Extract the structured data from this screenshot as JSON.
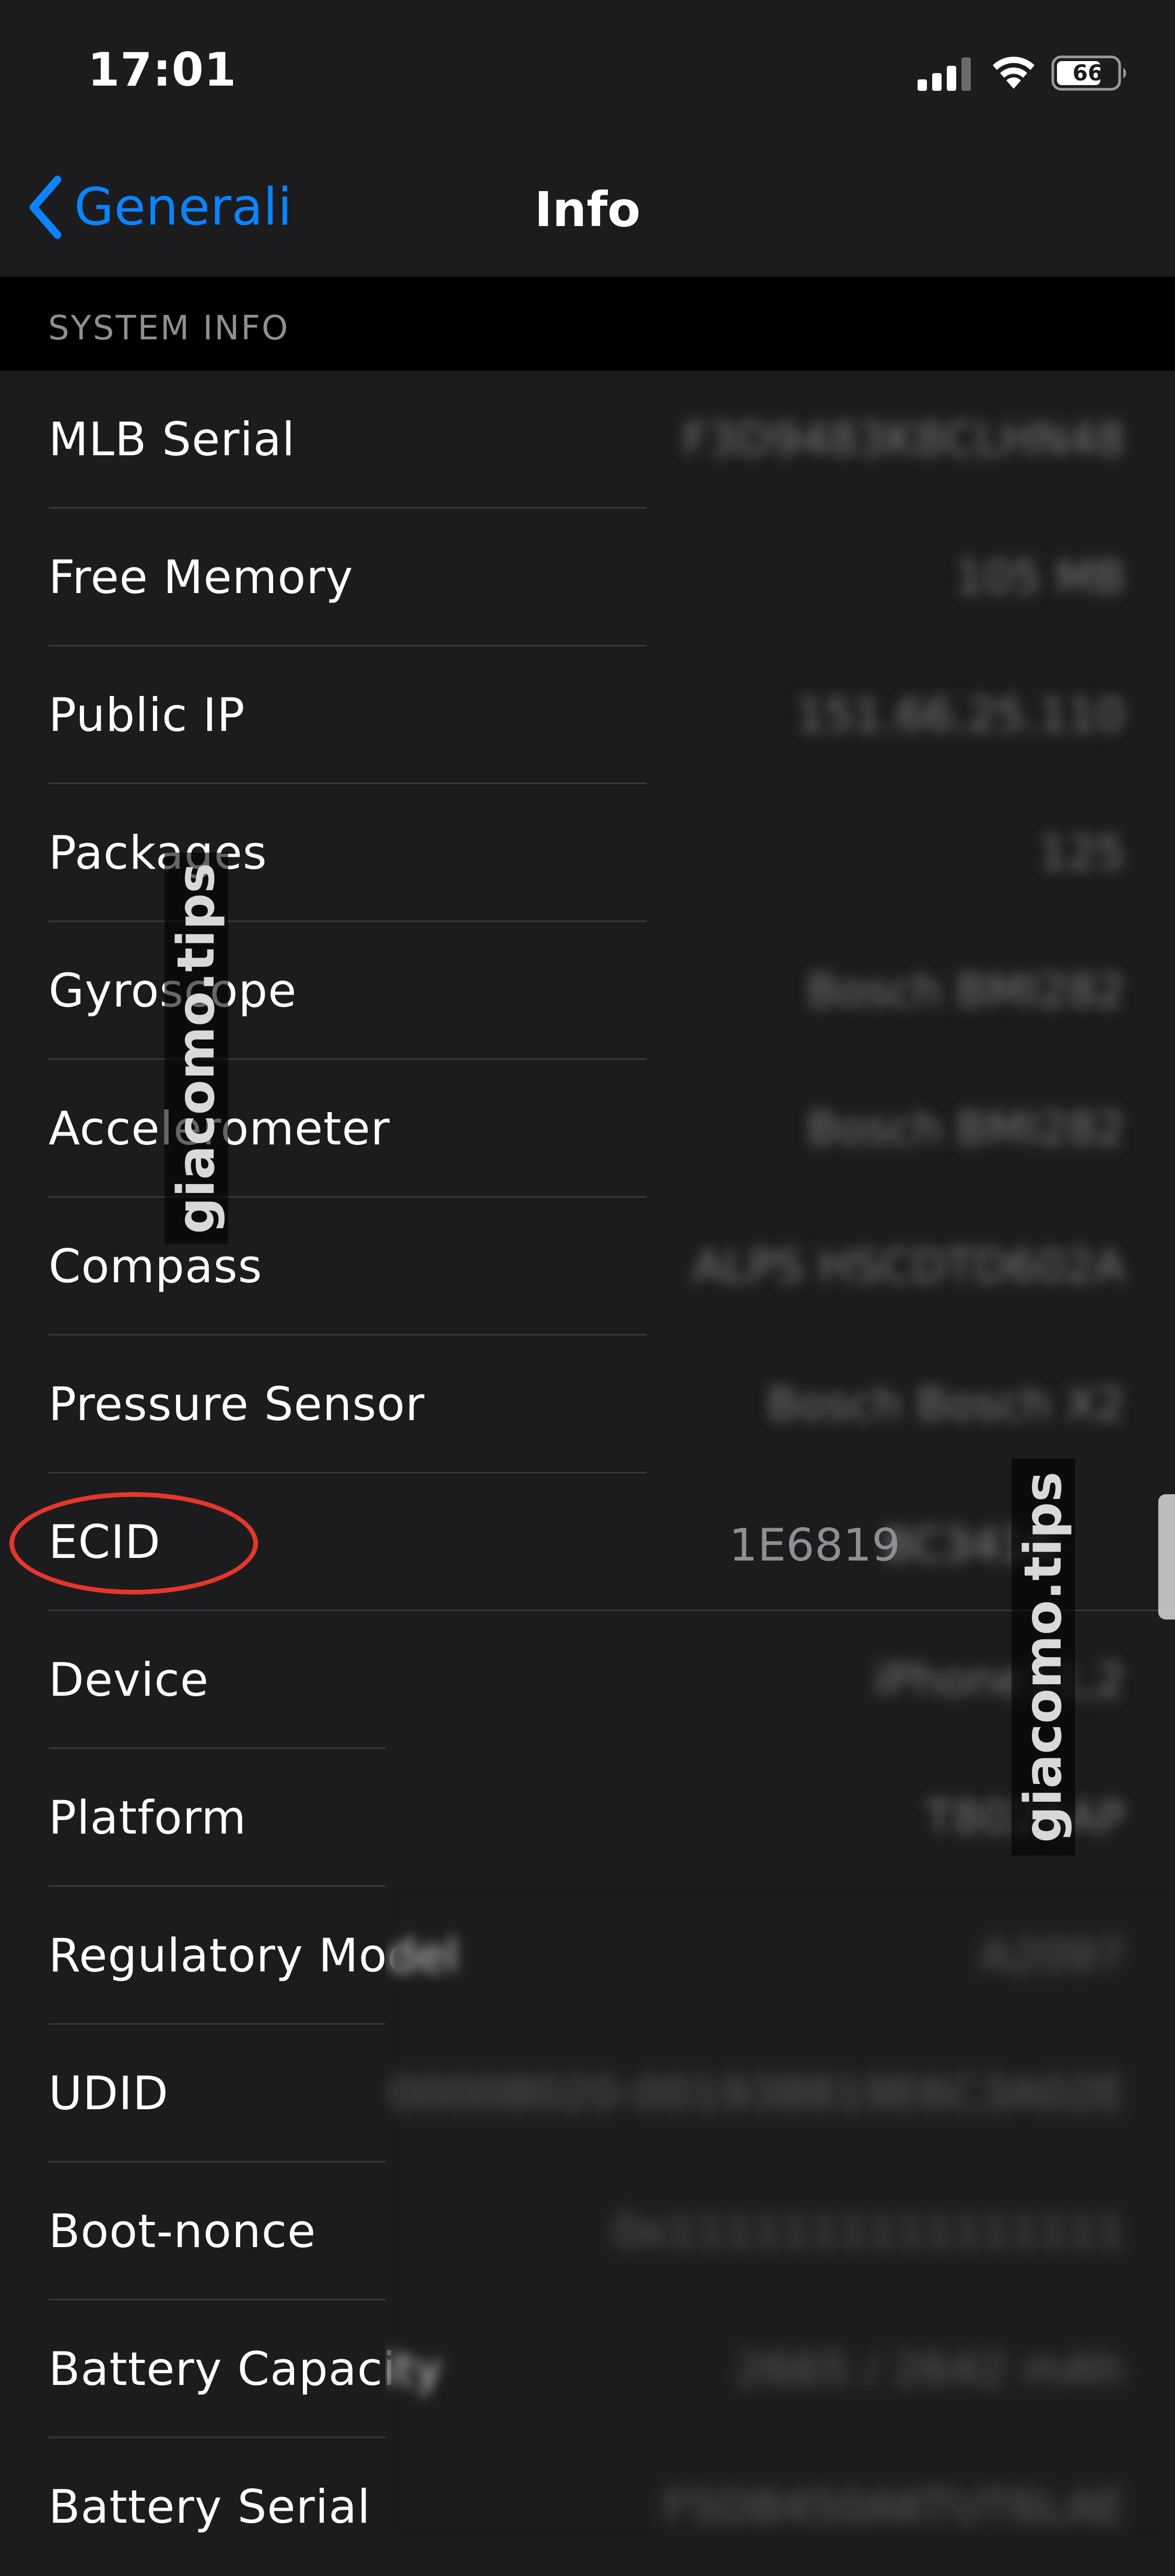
{
  "status_bar": {
    "time": "17:01",
    "battery_level": "66",
    "icons": [
      "signal-icon",
      "wifi-icon",
      "battery-icon"
    ]
  },
  "nav": {
    "back_label": "Generali",
    "title": "Info"
  },
  "section": {
    "title": "SYSTEM INFO"
  },
  "rows": [
    {
      "label": "MLB Serial",
      "value": "F3D9483K8CLHN48"
    },
    {
      "label": "Free Memory",
      "value": "105 MB"
    },
    {
      "label": "Public IP",
      "value": "151.66.25.110"
    },
    {
      "label": "Packages",
      "value": "125"
    },
    {
      "label": "Gyroscope",
      "value": "Bosch BMI282"
    },
    {
      "label": "Accelerometer",
      "value": "Bosch BMI282"
    },
    {
      "label": "Compass",
      "value": "ALPS HSCDTD602A"
    },
    {
      "label": "Pressure Sensor",
      "value": "Bosch Bosch X2"
    },
    {
      "label": "ECID",
      "value": "1E6819",
      "value_hidden": "8C3416"
    },
    {
      "label": "Device",
      "value": "iPhone11,2"
    },
    {
      "label": "Platform",
      "value": "T8020AP"
    },
    {
      "label": "Regulatory Model",
      "value": "A2097"
    },
    {
      "label": "UDID",
      "value": "00008020-001938819E6C3A02E"
    },
    {
      "label": "Boot-nonce",
      "value": "0x1111111111111111"
    },
    {
      "label": "Battery Capacity",
      "value": "2665 / 2642 mAh"
    },
    {
      "label": "Battery Serial",
      "value": "F5D8450AKTUT6LAE"
    }
  ],
  "watermark": "giacomo.tips",
  "colors": {
    "background": "#1c1c1e",
    "accent": "#0a84ff",
    "highlight": "#e5372a",
    "secondary_text": "#8e8e93"
  }
}
